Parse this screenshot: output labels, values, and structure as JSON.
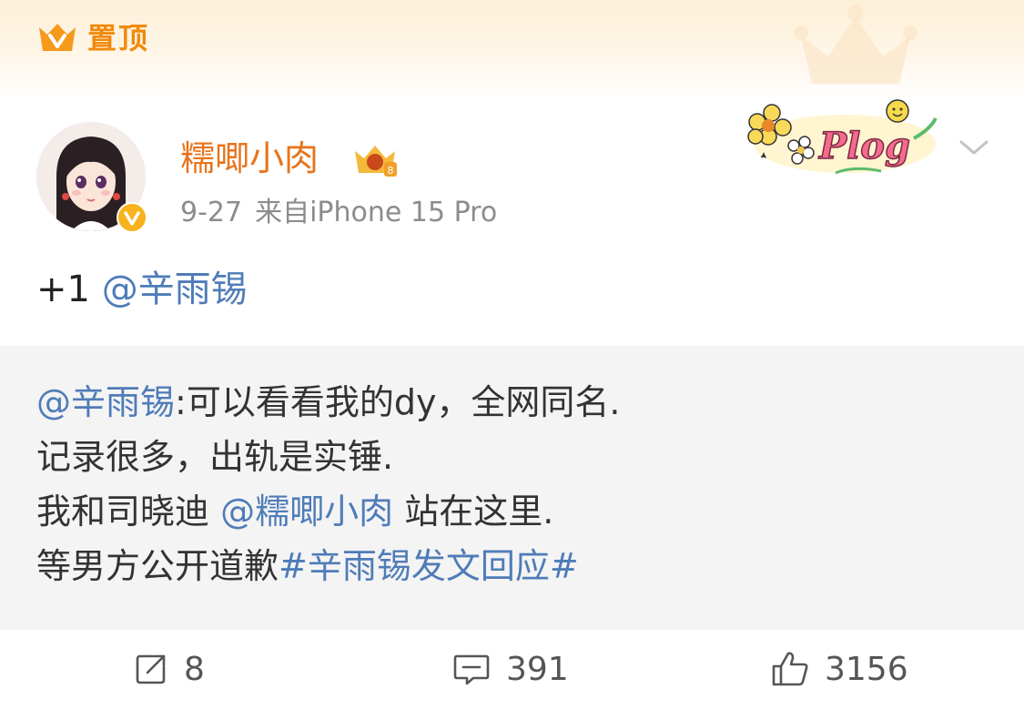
{
  "pin_banner": {
    "label": "置顶",
    "icon": "crown-v-icon",
    "accent_color": "#f08a0c"
  },
  "author": {
    "name": "糯唧小肉",
    "avatar": "avatar-illustration",
    "verified_icon": "verified-v-icon",
    "level_icon": "level-crown-badge-icon",
    "name_color": "#e8731a"
  },
  "meta": {
    "date": "9-27",
    "source": "来自iPhone 15 Pro"
  },
  "sticker": {
    "text": "Plog"
  },
  "post": {
    "prefix": "+1 ",
    "mention": "@辛雨锡"
  },
  "repost": {
    "line1": {
      "mention": "@辛雨锡",
      "text": ":可以看看我的dy，全网同名."
    },
    "line2": {
      "text": "记录很多，出轨是实锤."
    },
    "line3": {
      "text_before": "我和司晓迪 ",
      "mention": "@糯唧小肉",
      "text_after": " 站在这里."
    },
    "line4": {
      "text": "等男方公开道歉",
      "hashtag": "#辛雨锡发文回应#"
    }
  },
  "actions": {
    "repost": {
      "icon": "share-icon",
      "count": "8"
    },
    "comment": {
      "icon": "comment-icon",
      "count": "391"
    },
    "like": {
      "icon": "thumbs-up-icon",
      "count": "3156"
    }
  },
  "colors": {
    "link": "#4f7cb8",
    "meta_text": "#8c8c8c",
    "repost_bg": "#f4f4f4"
  }
}
